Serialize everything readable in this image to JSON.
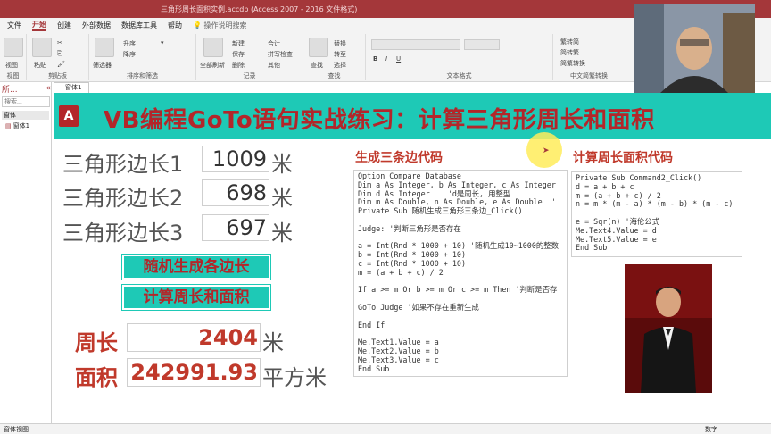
{
  "titlebar": {
    "text": "三角形周长面积实例.accdb (Access 2007 - 2016 文件格式)"
  },
  "tabs": [
    "文件",
    "开始",
    "创建",
    "外部数据",
    "数据库工具",
    "帮助"
  ],
  "tabs_active": "开始",
  "tell_me": "操作说明搜索",
  "ribbon": {
    "groups": [
      "视图",
      "剪贴板",
      "排序和筛选",
      "记录",
      "查找",
      "文本格式",
      "中文简繁转换"
    ],
    "items": {
      "view": "视图",
      "paste": "粘贴",
      "filter": "筛选器",
      "ascending": "升序",
      "descending": "降序",
      "refresh": "全部刷新",
      "new": "新建",
      "save": "保存",
      "delete": "删除",
      "totals": "合计",
      "spell": "拼写检查",
      "more": "其他",
      "find": "查找",
      "replace": "替换",
      "goto": "转至",
      "select": "选择",
      "to_trad": "繁转简",
      "to_simp": "简转繁",
      "convert": "简繁转换"
    }
  },
  "nav": {
    "title": "所...",
    "search_placeholder": "搜索...",
    "section": "窗体",
    "item": "窗体1"
  },
  "form_tab": "窗体1",
  "banner": {
    "logo_letter": "A",
    "title": "VB编程GoTo语句实战练习：计算三角形周长和面积",
    "accent": "#1ec9b6",
    "title_color": "#b3262a"
  },
  "sides": [
    {
      "label": "三角形边长1",
      "value": "1009",
      "unit": "米"
    },
    {
      "label": "三角形边长2",
      "value": "698",
      "unit": "米"
    },
    {
      "label": "三角形边长3",
      "value": "697",
      "unit": "米"
    }
  ],
  "buttons": {
    "generate": "随机生成各边长",
    "compute": "计算周长和面积"
  },
  "results": {
    "perimeter_label": "周长",
    "perimeter_value": "2404",
    "perimeter_unit": "米",
    "area_label": "面积",
    "area_value": "242991.93",
    "area_unit": "平方米"
  },
  "code1": {
    "heading": "生成三条边代码",
    "lines": [
      "Option Compare Database",
      "Dim a As Integer, b As Integer, c As Integer",
      "Dim d As Integer    'd是周长, 用整型",
      "Dim m As Double, n As Double, e As Double  '",
      "Private Sub 随机生成三角形三条边_Click()",
      "",
      "Judge: '判断三角形是否存在",
      "",
      "a = Int(Rnd * 1000 + 10) '随机生成10~1000的整数",
      "b = Int(Rnd * 1000 + 10)",
      "c = Int(Rnd * 1000 + 10)",
      "m = (a + b + c) / 2",
      "",
      "If a >= m Or b >= m Or c >= m Then '判断是否存",
      "",
      "GoTo Judge '如果不存在重新生成",
      "",
      "End If",
      "",
      "Me.Text1.Value = a",
      "Me.Text2.Value = b",
      "Me.Text3.Value = c",
      "End Sub"
    ]
  },
  "code2": {
    "heading": "计算周长面积代码",
    "lines": [
      "Private Sub Command2_Click()",
      "d = a + b + c",
      "m = (a + b + c) / 2",
      "n = m * (m - a) * (m - b) * (m - c)",
      "",
      "e = Sqr(n) '海伦公式",
      "Me.Text4.Value = d",
      "Me.Text5.Value = e",
      "End Sub"
    ]
  },
  "statusbar": {
    "left": "窗体视图",
    "right": "数字"
  }
}
